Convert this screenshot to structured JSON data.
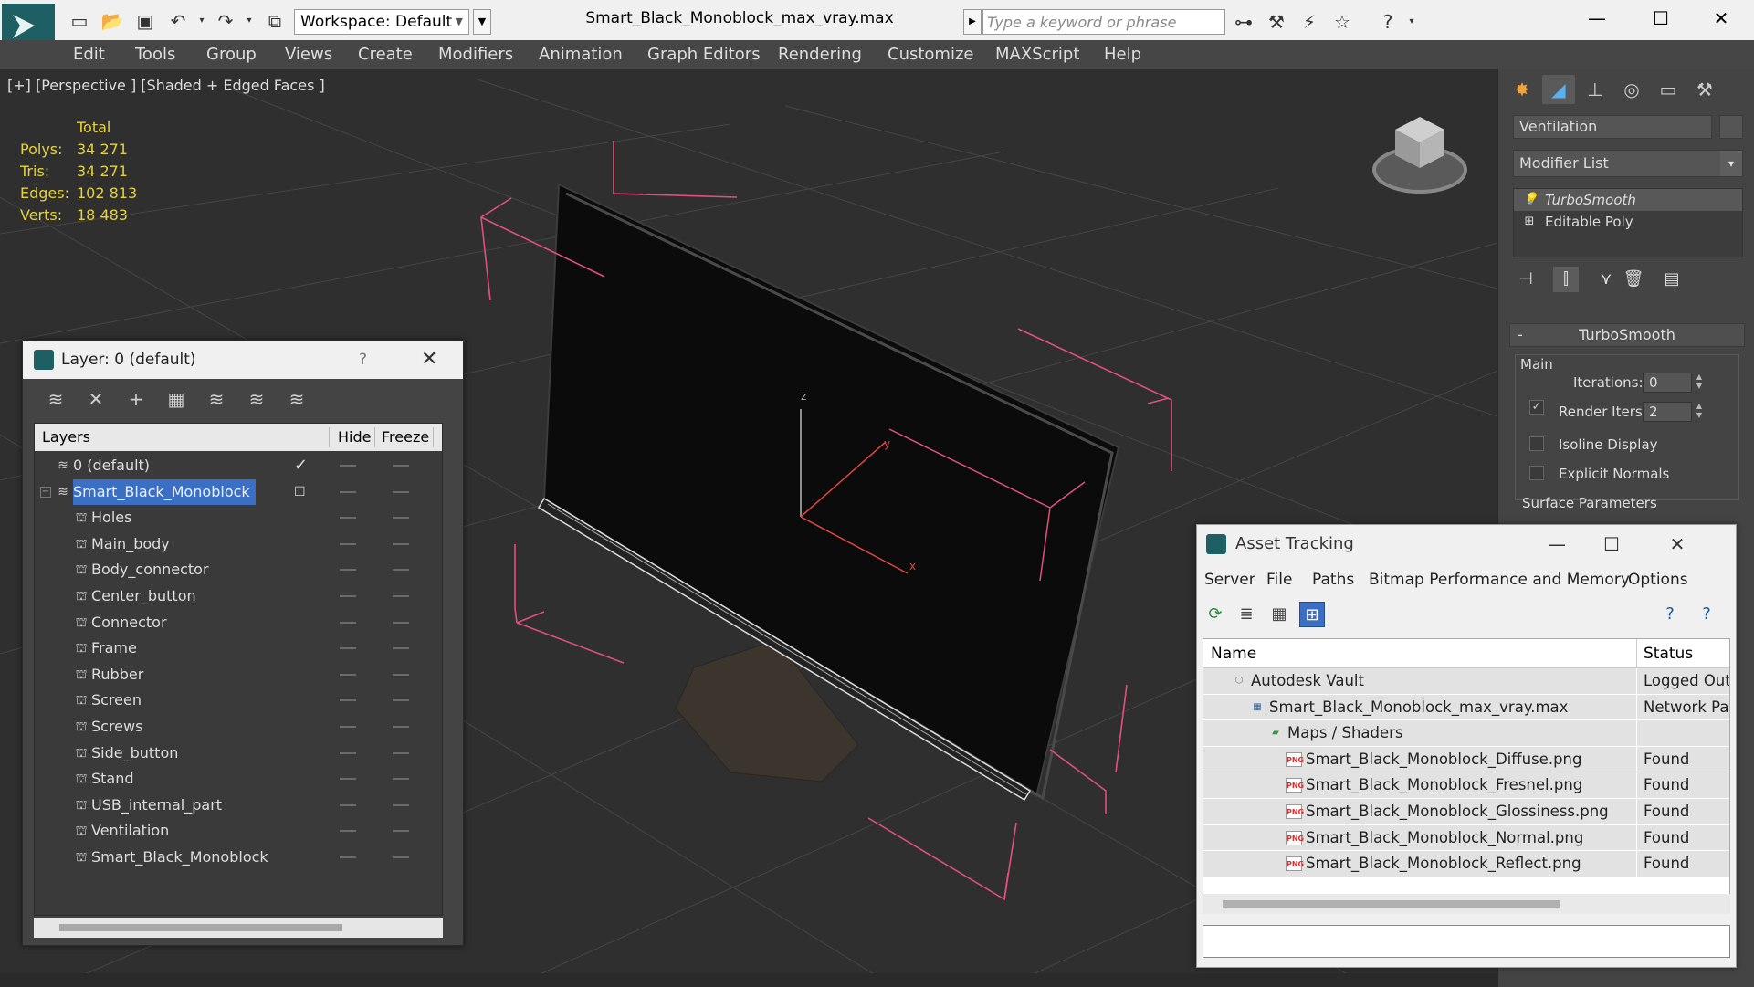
{
  "titlebar": {
    "workspace": "Workspace: Default",
    "document_title": "Smart_Black_Monoblock_max_vray.max",
    "search_placeholder": "Type a keyword or phrase"
  },
  "menubar": {
    "items": [
      "Edit",
      "Tools",
      "Group",
      "Views",
      "Create",
      "Modifiers",
      "Animation",
      "Graph Editors",
      "Rendering",
      "Customize",
      "MAXScript",
      "Help"
    ]
  },
  "viewport": {
    "label": "[+] [Perspective ] [Shaded + Edged Faces ]",
    "stats": {
      "header": "Total",
      "rows": [
        {
          "key": "Polys:",
          "value": "34 271"
        },
        {
          "key": "Tris:",
          "value": "34 271"
        },
        {
          "key": "Edges:",
          "value": "102 813"
        },
        {
          "key": "Verts:",
          "value": "18 483"
        }
      ]
    },
    "axis": {
      "z": "z",
      "y": "y",
      "x": "x"
    }
  },
  "command_panel": {
    "object_name": "Ventilation",
    "modifier_list": "Modifier List",
    "stack": [
      {
        "label": "TurboSmooth",
        "selected": true
      },
      {
        "label": "Editable Poly",
        "selected": false
      }
    ],
    "turbosmooth": {
      "title": "TurboSmooth",
      "group_main": "Main",
      "iterations_label": "Iterations:",
      "iterations_value": "0",
      "render_iters_label": "Render Iters:",
      "render_iters_value": "2",
      "render_iters_checked": true,
      "isoline_label": "Isoline Display",
      "explicit_normals_label": "Explicit Normals",
      "surface_params": "Surface Parameters"
    }
  },
  "layer_explorer": {
    "title": "Layer: 0 (default)",
    "help": "?",
    "columns": {
      "layers": "Layers",
      "hide": "Hide",
      "freeze": "Freeze"
    },
    "rows": [
      {
        "name": "0 (default)",
        "level": 0,
        "type": "layer",
        "active": true
      },
      {
        "name": "Smart_Black_Monoblock",
        "level": 0,
        "type": "layer",
        "selected": true
      },
      {
        "name": "Holes",
        "level": 1,
        "type": "object"
      },
      {
        "name": "Main_body",
        "level": 1,
        "type": "object"
      },
      {
        "name": "Body_connector",
        "level": 1,
        "type": "object"
      },
      {
        "name": "Center_button",
        "level": 1,
        "type": "object"
      },
      {
        "name": "Connector",
        "level": 1,
        "type": "object"
      },
      {
        "name": "Frame",
        "level": 1,
        "type": "object"
      },
      {
        "name": "Rubber",
        "level": 1,
        "type": "object"
      },
      {
        "name": "Screen",
        "level": 1,
        "type": "object"
      },
      {
        "name": "Screws",
        "level": 1,
        "type": "object"
      },
      {
        "name": "Side_button",
        "level": 1,
        "type": "object"
      },
      {
        "name": "Stand",
        "level": 1,
        "type": "object"
      },
      {
        "name": "USB_internal_part",
        "level": 1,
        "type": "object"
      },
      {
        "name": "Ventilation",
        "level": 1,
        "type": "object"
      },
      {
        "name": "Smart_Black_Monoblock",
        "level": 1,
        "type": "object"
      }
    ]
  },
  "asset_tracking": {
    "title": "Asset Tracking",
    "menu": [
      "Server",
      "File",
      "Paths",
      "Bitmap Performance and Memory",
      "Options"
    ],
    "columns": {
      "name": "Name",
      "status": "Status"
    },
    "rows": [
      {
        "name": "Autodesk Vault",
        "status": "Logged Out",
        "level": 0,
        "icon": "vault"
      },
      {
        "name": "Smart_Black_Monoblock_max_vray.max",
        "status": "Network Pat",
        "level": 1,
        "icon": "max"
      },
      {
        "name": "Maps / Shaders",
        "status": "",
        "level": 2,
        "icon": "maps"
      },
      {
        "name": "Smart_Black_Monoblock_Diffuse.png",
        "status": "Found",
        "level": 3,
        "icon": "png"
      },
      {
        "name": "Smart_Black_Monoblock_Fresnel.png",
        "status": "Found",
        "level": 3,
        "icon": "png"
      },
      {
        "name": "Smart_Black_Monoblock_Glossiness.png",
        "status": "Found",
        "level": 3,
        "icon": "png"
      },
      {
        "name": "Smart_Black_Monoblock_Normal.png",
        "status": "Found",
        "level": 3,
        "icon": "png"
      },
      {
        "name": "Smart_Black_Monoblock_Reflect.png",
        "status": "Found",
        "level": 3,
        "icon": "png"
      }
    ]
  },
  "colors": {
    "accent": "#3b6fc4",
    "stats": "#e6d23c",
    "bbox": "#e0507a",
    "app_logo": "#1d5f63"
  }
}
